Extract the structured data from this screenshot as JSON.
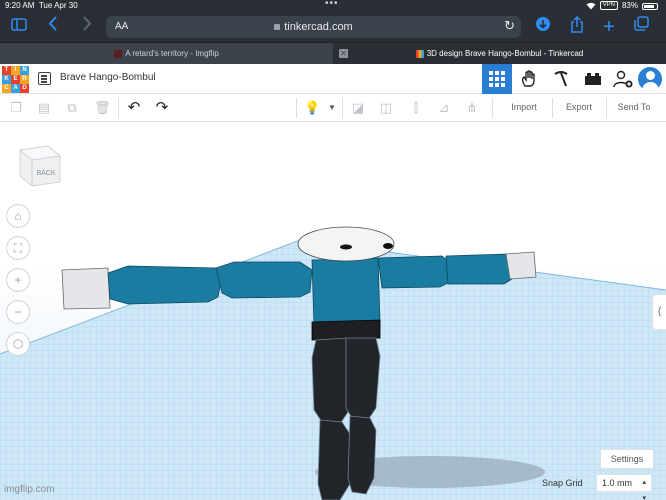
{
  "status_bar": {
    "time": "9:20 AM",
    "date": "Tue Apr 30",
    "vpn": "VPN",
    "battery": "83%"
  },
  "browser": {
    "text_size_label": "AA",
    "url": "tinkercad.com",
    "tabs": [
      {
        "title": "A retard's territory - Imgflip",
        "active": false
      },
      {
        "title": "3D design Brave Hango-Bombul - Tinkercad",
        "active": true
      }
    ],
    "accent_color": "#2f8cf0"
  },
  "tinkercad": {
    "logo_letters": [
      "T",
      "I",
      "N",
      "K",
      "E",
      "R",
      "C",
      "A",
      "D"
    ],
    "logo_colors": [
      "#e8412e",
      "#f5a623",
      "#3aa0dc",
      "#3aa0dc",
      "#e8412e",
      "#f5a623",
      "#f5a623",
      "#3aa0dc",
      "#e8412e"
    ],
    "design_title": "Brave Hango-Bombul",
    "header_buttons": [
      "grid-view",
      "tinker-hand",
      "build-pickaxe",
      "bricks",
      "add-user",
      "avatar"
    ],
    "toolbar": {
      "import_label": "Import",
      "export_label": "Export",
      "send_to_label": "Send To"
    },
    "viewcube_label": "BACK",
    "settings_label": "Settings",
    "snap_grid_label": "Snap Grid",
    "snap_grid_value": "1.0 mm",
    "brand_color": "#2a7fd4"
  },
  "watermark": "imgflip.com"
}
